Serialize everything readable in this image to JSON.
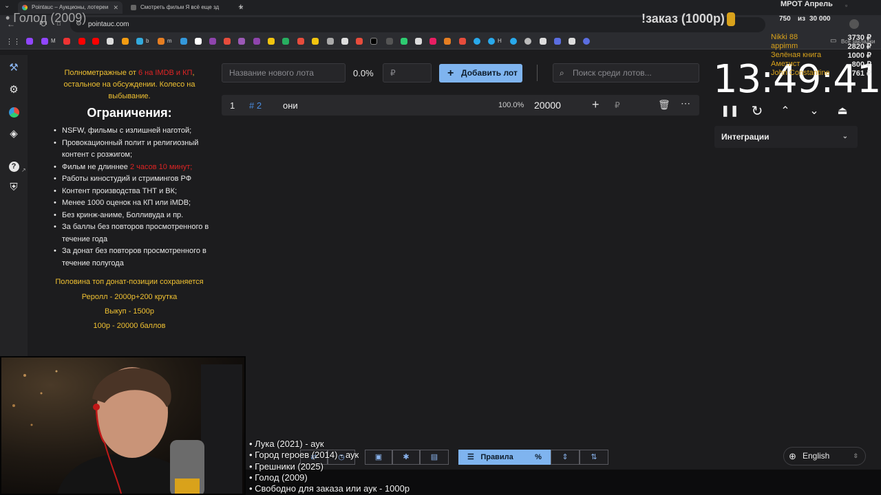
{
  "browser": {
    "tabs": [
      {
        "title": "Pointauc – Аукционы, лотереи",
        "active": true
      },
      {
        "title": "Смотреть фильм Я всё еще зд",
        "active": false
      }
    ],
    "url": "pointauc.com",
    "all_bookmarks_label": "Все закладки",
    "bookmark_labels": [
      "M",
      "b",
      "m",
      "H"
    ]
  },
  "overlay": {
    "current_movie": "• Голод (2009)",
    "order_title": "!заказ (1000р)",
    "mrot_title": "МРОТ Апрель",
    "mrot_progress": "750",
    "mrot_separator": "из",
    "mrot_goal": "30 000",
    "donors": [
      {
        "name": "Nikki 88",
        "amount": "3730 ₽"
      },
      {
        "name": "appimm",
        "amount": "2820 ₽"
      },
      {
        "name": "Зелёная книга",
        "amount": "1000 ₽"
      },
      {
        "name": "Аметист",
        "amount": "800 ₽"
      },
      {
        "name": "John Constantine",
        "amount": "761 ₽"
      }
    ]
  },
  "rules": {
    "intro_prefix": "Полнометражные от",
    "intro_highlight": "6 на IMDB и КП",
    "intro_suffix": ",",
    "intro_line2": "остальное на обсуждении. Колесо на",
    "intro_line3": "выбывание.",
    "heading": "Ограничения:",
    "items": [
      {
        "text": "NSFW, фильмы с излишней наготой;"
      },
      {
        "text": "Провокационный полит и религиозный контент с розжигом;"
      },
      {
        "text": "Фильм не длиннее ",
        "highlight": "2 часов 10 минут;"
      },
      {
        "text": "Работы киностудий и стримингов РФ"
      },
      {
        "text": "Контент производства ТНТ и ВК;"
      },
      {
        "text": "Менее 1000 оценок на КП или iMDB;"
      },
      {
        "text": "Без кринж-аниме, Болливуда и пр."
      },
      {
        "text": "За баллы без повторов просмотренного в течение года"
      },
      {
        "text": "За донат без повторов просмотренного в течение полугода"
      }
    ],
    "note1": "Половина топ донат-позиции сохраняется",
    "note2": "Реролл - 2000р+200 крутка",
    "note3": "Выкуп - 1500р",
    "note4": "100р - 20000 баллов"
  },
  "controls": {
    "new_lot_placeholder": "Название нового лота",
    "percent": "0.0%",
    "amount_placeholder": "₽",
    "add_button": "Добавить лот",
    "search_placeholder": "Поиск среди лотов..."
  },
  "lots": [
    {
      "index": "1",
      "id": "# 2",
      "name": "они",
      "percent": "100.0%",
      "amount": "20000",
      "currency": "₽"
    }
  ],
  "timer": {
    "time": "13:49:41",
    "integrations_label": "Интеграции"
  },
  "bottom": {
    "rules_label": "Правила",
    "percent_icon": "%",
    "language": "English"
  },
  "ticker": [
    "• Лука (2021) - аук",
    "• Город героев (2014) - аук",
    "• Грешники (2025)",
    "• Голод (2009)",
    "• Свободно для заказа или аук - 1000р"
  ],
  "colors": {
    "accent": "#7fb4ef",
    "rules_yellow": "#f1c232",
    "rules_red": "#e02424",
    "donor_yellow": "#d9a21b"
  }
}
